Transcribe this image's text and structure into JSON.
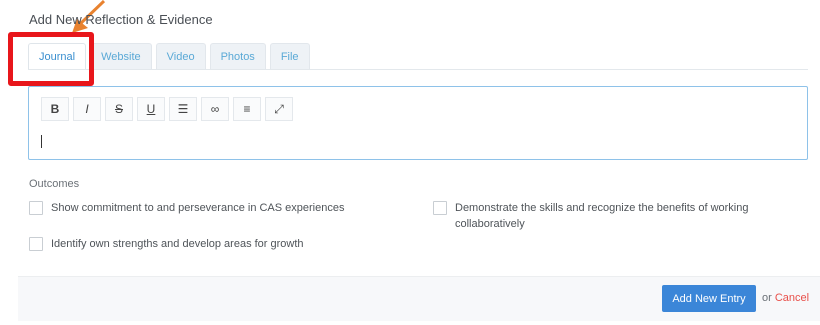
{
  "panel": {
    "title": "Add New Reflection & Evidence"
  },
  "tabs": [
    {
      "label": "Journal"
    },
    {
      "label": "Website"
    },
    {
      "label": "Video"
    },
    {
      "label": "Photos"
    },
    {
      "label": "File"
    }
  ],
  "toolbar": {
    "buttons": [
      {
        "icon": "bold-icon",
        "glyph": "B"
      },
      {
        "icon": "italic-icon",
        "glyph": "I"
      },
      {
        "icon": "strikethrough-icon",
        "glyph": "S"
      },
      {
        "icon": "underline-icon",
        "glyph": "U"
      },
      {
        "icon": "bullet-list-icon",
        "glyph": "☰"
      },
      {
        "icon": "link-icon",
        "glyph": "∞"
      },
      {
        "icon": "align-icon",
        "glyph": "≡"
      },
      {
        "icon": "fullscreen-icon",
        "glyph": "⤢"
      }
    ]
  },
  "outcomes": {
    "label": "Outcomes",
    "items": [
      {
        "label": "Show commitment to and perseverance in CAS experiences"
      },
      {
        "label": "Demonstrate the skills and recognize the benefits of working",
        "label2": "collaboratively"
      },
      {
        "label": "Identify own strengths and develop areas for growth"
      }
    ]
  },
  "footer": {
    "add_label": "Add New Entry",
    "or_label": "or",
    "cancel_label": "Cancel"
  },
  "colors": {
    "annotation_box": "#e8161b",
    "annotation_arrow": "#e8822f",
    "primary_button": "#3b86d8",
    "cancel_link": "#e8504a"
  }
}
